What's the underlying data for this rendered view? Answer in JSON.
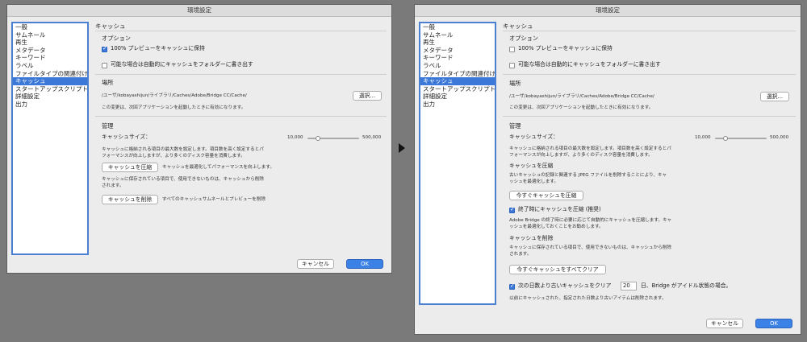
{
  "windowTitle": "環境設定",
  "sidebarItems": [
    "一般",
    "サムネール",
    "再生",
    "メタデータ",
    "キーワード",
    "ラベル",
    "ファイルタイプの関連付け",
    "キャッシュ",
    "スタートアップスクリプト",
    "詳細設定",
    "出力"
  ],
  "selectedSidebarIndex": 7,
  "accentColor": "#3b78d8",
  "before": {
    "panelTitle": "キャッシュ",
    "options": {
      "heading": "オプション",
      "keepPreviews": {
        "label": "100% プレビューをキャッシュに保持",
        "checked": true
      },
      "writeToFolders": {
        "label": "可能な場合は自動的にキャッシュをフォルダーに書き出す",
        "checked": false
      }
    },
    "location": {
      "heading": "場所",
      "path": "/ユーザ/kobayashijun/ライブラリ/Caches/Adobe/Bridge CC/Cache/",
      "choose": "選択...",
      "note": "この変更は、次回アプリケーションを起動したときに有効になります。"
    },
    "management": {
      "heading": "管理",
      "sizeLabel": "キャッシュサイズ：",
      "sliderMin": "10,000",
      "sliderMax": "500,000",
      "sliderFraction": 0.2,
      "desc1": "キャッシュに格納される項目の最大数を設定します。項目数を高く設定するとパ",
      "desc2": "フォーマンスが向上しますが、より多くのディスク容量を消費します。",
      "compactButton": "キャッシュを圧縮",
      "compactDesc": "キャッシュを最適化してパフォーマンスを向上します。",
      "purgeDesc1": "キャッシュに保存されている項目で、使用できないものは、キャッシュから削除",
      "purgeDesc2": "されます。",
      "purgeButton": "キャッシュを削除",
      "purgeButtonDesc": "すべてのキャッシュサムネールとプレビューを削除"
    },
    "cancel": "キャンセル",
    "ok": "OK"
  },
  "after": {
    "panelTitle": "キャッシュ",
    "options": {
      "heading": "オプション",
      "keepPreviews": {
        "label": "100% プレビューをキャッシュに保持",
        "checked": false
      },
      "writeToFolders": {
        "label": "可能な場合は自動的にキャッシュをフォルダーに書き出す",
        "checked": false
      }
    },
    "location": {
      "heading": "場所",
      "path": "/ユーザ/kobayashijun/ライブラリ/Caches/Adobe/Bridge CC/Cache/",
      "choose": "選択...",
      "note": "この変更は、次回アプリケーションを起動したときに有効になります。"
    },
    "management": {
      "heading": "管理",
      "sizeLabel": "キャッシュサイズ：",
      "sliderMin": "10,000",
      "sliderMax": "500,000",
      "sliderFraction": 0.2,
      "desc1": "キャッシュに格納される項目の最大数を設定します。項目数を高く設定するとパ",
      "desc2": "フォーマンスが向上しますが、より多くのディスク容量を消費します。",
      "compactHeading": "キャッシュを圧縮",
      "compactDesc1": "古いキャッシュの記録と関連する JPEG ファイルを削除することにより、キャ",
      "compactDesc2": "ッシュを最適化します。",
      "compactNowButton": "今すぐキャッシュを圧縮",
      "autoCompact": {
        "label": "終了時にキャッシュを圧縮 (推奨)",
        "checked": true
      },
      "autoCompactDesc1": "Adobe Bridge の終了時に必要に応じて自動的にキャッシュを圧縮します。キャ",
      "autoCompactDesc2": "ッシュを最適化しておくことをお勧めします。",
      "purgeHeading": "キャッシュを削除",
      "purgeDesc1": "キャッシュに保存されている項目で、使用できないものは、キャッシュから削除",
      "purgeDesc2": "されます。",
      "clearAllButton": "今すぐキャッシュをすべてクリア",
      "autoClear": {
        "labelBefore": "次の日数より古いキャッシュをクリア",
        "days": "20",
        "labelAfter": "日、Bridge がアイドル状態の場合。",
        "checked": true
      },
      "autoClearDesc": "以前にキャッシュされた、指定された日数より古いアイテムは削除されます。"
    },
    "cancel": "キャンセル",
    "ok": "OK"
  }
}
